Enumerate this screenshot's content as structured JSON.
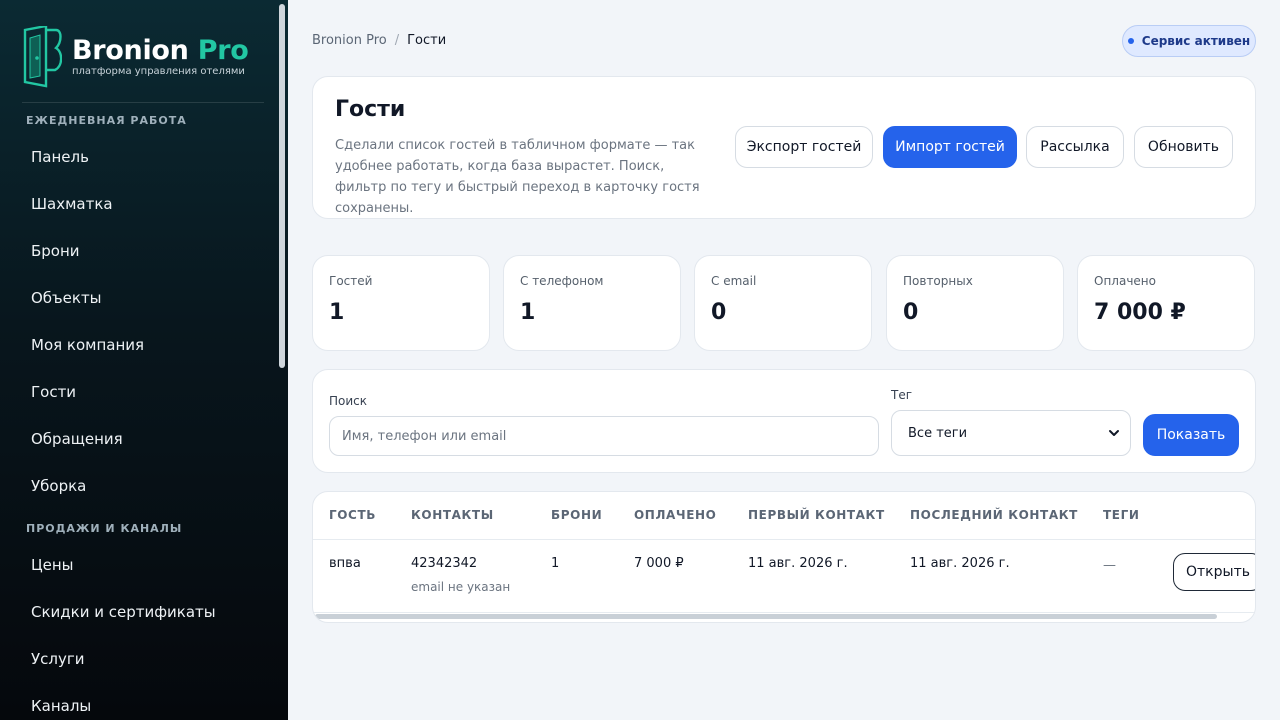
{
  "brand": {
    "name": "Bronion",
    "name_accent": "Pro",
    "tagline": "платформа управления отелями",
    "accent_color": "#22c7a3"
  },
  "sidebar": {
    "sections": [
      {
        "title": "ЕЖЕДНЕВНАЯ РАБОТА",
        "items": [
          "Панель",
          "Шахматка",
          "Брони",
          "Объекты",
          "Моя компания",
          "Гости",
          "Обращения",
          "Уборка"
        ]
      },
      {
        "title": "ПРОДАЖИ И КАНАЛЫ",
        "items": [
          "Цены",
          "Скидки и сертификаты",
          "Услуги",
          "Каналы"
        ]
      }
    ]
  },
  "breadcrumb": {
    "root": "Bronion Pro",
    "separator": "/",
    "current": "Гости"
  },
  "status": {
    "label": "Сервис активен",
    "color": "#2563eb"
  },
  "header": {
    "title": "Гости",
    "description": "Сделали список гостей в табличном формате — так удобнее работать, когда база вырастет. Поиск, фильтр по тегу и быстрый переход в карточку гостя сохранены.",
    "buttons": {
      "export": "Экспорт гостей",
      "import": "Импорт гостей",
      "mailing": "Рассылка",
      "refresh": "Обновить"
    }
  },
  "stats": [
    {
      "label": "Гостей",
      "value": "1"
    },
    {
      "label": "С телефоном",
      "value": "1"
    },
    {
      "label": "С email",
      "value": "0"
    },
    {
      "label": "Повторных",
      "value": "0"
    },
    {
      "label": "Оплачено",
      "value": "7 000 ₽"
    }
  ],
  "filters": {
    "search_label": "Поиск",
    "search_placeholder": "Имя, телефон или email",
    "search_value": "",
    "tag_label": "Тег",
    "tag_value": "Все теги",
    "show_button": "Показать"
  },
  "table": {
    "columns": [
      "ГОСТЬ",
      "КОНТАКТЫ",
      "БРОНИ",
      "ОПЛАЧЕНО",
      "ПЕРВЫЙ КОНТАКТ",
      "ПОСЛЕДНИЙ КОНТАКТ",
      "ТЕГИ"
    ],
    "rows": [
      {
        "guest": "впва",
        "phone": "42342342",
        "email": "email не указан",
        "bookings": "1",
        "paid": "7 000 ₽",
        "first_contact": "11 авг. 2026 г.",
        "last_contact": "11 авг. 2026 г.",
        "tags": "—",
        "action": "Открыть"
      }
    ]
  },
  "colors": {
    "primary": "#2563eb",
    "sidebar_bg": "#08161d",
    "page_bg": "#f2f5f9"
  }
}
